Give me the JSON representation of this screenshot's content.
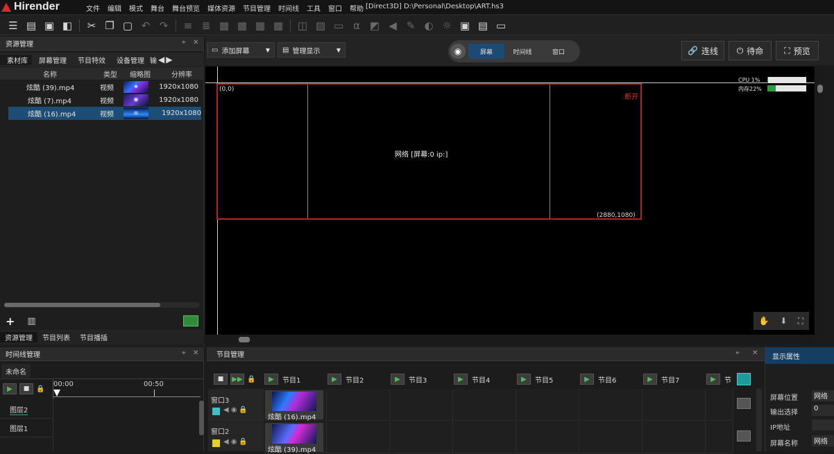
{
  "app": {
    "name": "Hirender",
    "path": "[Direct3D]  D:\\Personal\\Desktop\\ART.hs3"
  },
  "menu": [
    "文件",
    "编辑",
    "模式",
    "舞台",
    "舞台预览",
    "媒体资源",
    "节目管理",
    "时间线",
    "工具",
    "窗口",
    "帮助"
  ],
  "toolbar_icons": [
    "hamburger-icon",
    "open-icon",
    "save-icon",
    "save-as-icon",
    "cut-icon",
    "copy-icon",
    "paste-icon",
    "undo-icon",
    "redo-icon",
    "align-left-icon",
    "align-center-icon",
    "grid-icon",
    "grid2-icon",
    "grid3-icon",
    "grid4-icon",
    "link-icon",
    "image-icon",
    "crop-icon",
    "alpha-icon",
    "media-icon",
    "volume-icon",
    "pen-icon",
    "contrast-icon",
    "sun-icon",
    "window-icon",
    "layout-icon",
    "monitor-icon"
  ],
  "left": {
    "title": "资源管理",
    "tabs": [
      "素材库",
      "屏幕管理",
      "节目特效",
      "设备管理",
      "输"
    ],
    "columns": [
      "名称",
      "类型",
      "缩略图",
      "分辨率"
    ],
    "rows": [
      {
        "name": "炫酷 (39).mp4",
        "type": "视频",
        "res": "1920x1080"
      },
      {
        "name": "炫酷 (7).mp4",
        "type": "视频",
        "res": "1920x1080"
      },
      {
        "name": "炫酷 (16).mp4",
        "type": "视频",
        "res": "1920x1080"
      }
    ],
    "bottom_tabs": [
      "资源管理",
      "节目列表",
      "节目播插"
    ]
  },
  "viewport": {
    "add_screen": "添加屏幕",
    "manage_display": "管理显示",
    "seg": [
      "屏幕",
      "时间线",
      "窗口"
    ],
    "btn_connect": "连线",
    "btn_standby": "待命",
    "btn_preview": "预览",
    "cpu": "CPU 1%",
    "mem": "内存22%",
    "cpu_pct": 1,
    "mem_pct": 22,
    "coord_tl": "(0,0)",
    "coord_br": "(2880,1080)",
    "center_label": "网络 [屏幕:0 ip:]",
    "disconnect": "断开"
  },
  "timeline": {
    "title": "时间线管理",
    "tab": "未命名",
    "t0": "00:00",
    "t1": "00:50",
    "layers": [
      "图层2",
      "图层1"
    ]
  },
  "programs": {
    "title": "节目管理",
    "items": [
      "节目1",
      "节目2",
      "节目3",
      "节目4",
      "节目5",
      "节目6",
      "节目7",
      "节"
    ],
    "windows": [
      {
        "label": "窗口3",
        "color": "#3fc0c6",
        "clip": "炫酷 (16).mp4"
      },
      {
        "label": "窗口2",
        "color": "#e3d12a",
        "clip": "炫酷 (39).mp4"
      }
    ]
  },
  "props": {
    "title": "显示属性",
    "rows": [
      {
        "label": "屏幕位置",
        "value": "网络"
      },
      {
        "label": "输出选择",
        "value": "0"
      },
      {
        "label": "IP地址",
        "value": ""
      },
      {
        "label": "屏幕名称",
        "value": "网络"
      }
    ]
  }
}
